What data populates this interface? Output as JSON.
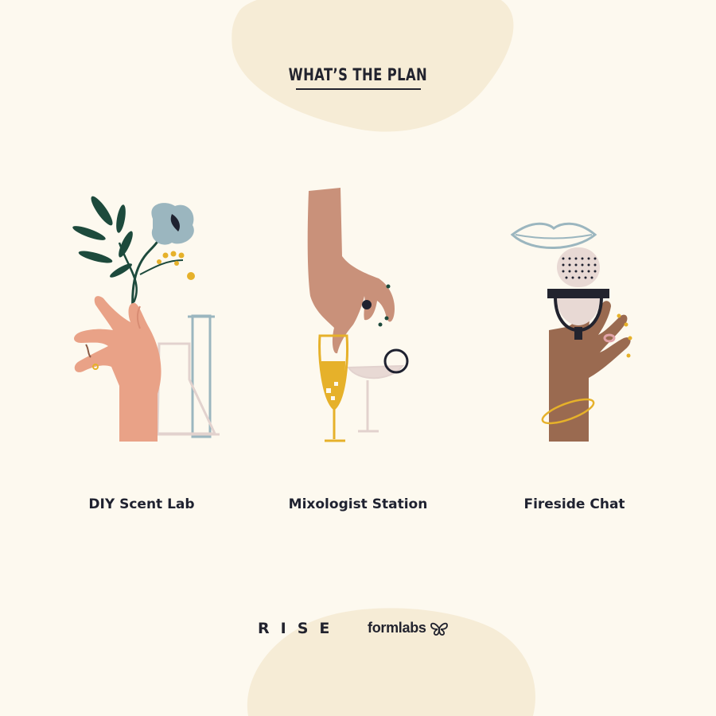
{
  "header": {
    "title": "WHAT’S THE PLAN"
  },
  "activities": [
    {
      "label": "DIY Scent Lab"
    },
    {
      "label": "Mixologist Station"
    },
    {
      "label": "Fireside Chat"
    }
  ],
  "footer": {
    "rise_logo": "RISE",
    "formlabs_logo": "formlabs"
  },
  "colors": {
    "background": "#fdf9ef",
    "blob": "#f6ecd6",
    "text": "#1f2230",
    "accent_yellow": "#e6b12a",
    "accent_blue": "#9bb6bf",
    "leaf_green": "#1d4a3c"
  },
  "icons": [
    "flower-hand-icon",
    "cocktail-hand-icon",
    "microphone-hand-icon",
    "butterfly-icon"
  ]
}
